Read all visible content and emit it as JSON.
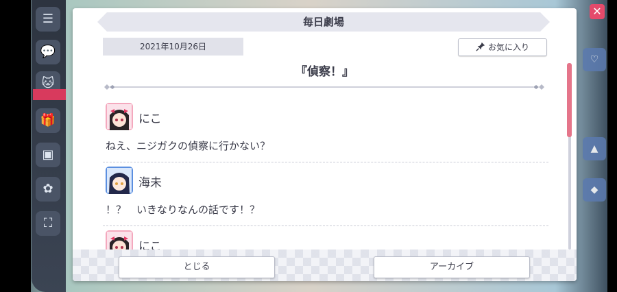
{
  "dialog": {
    "title": "毎日劇場",
    "date": "2021年10月26日",
    "favorite_label": "お気に入り",
    "story_title": "『偵察！』"
  },
  "entries": [
    {
      "speaker": "にこ",
      "text": "ねえ、ニジガクの偵察に行かない？"
    },
    {
      "speaker": "海未",
      "text": "！？　いきなりなんの話です！？"
    },
    {
      "speaker": "にこ",
      "text": ""
    }
  ],
  "footer": {
    "close_label": "とじる",
    "archive_label": "アーカイブ"
  },
  "colors": {
    "accent": "#e5758a",
    "panel": "#ffffff",
    "text": "#3b3c4a"
  },
  "icons": [
    "menu-icon",
    "chat-icon",
    "cat-icon",
    "gift-icon",
    "chart-icon",
    "pet-icon",
    "fullscreen-icon",
    "pin-icon",
    "close-icon"
  ]
}
